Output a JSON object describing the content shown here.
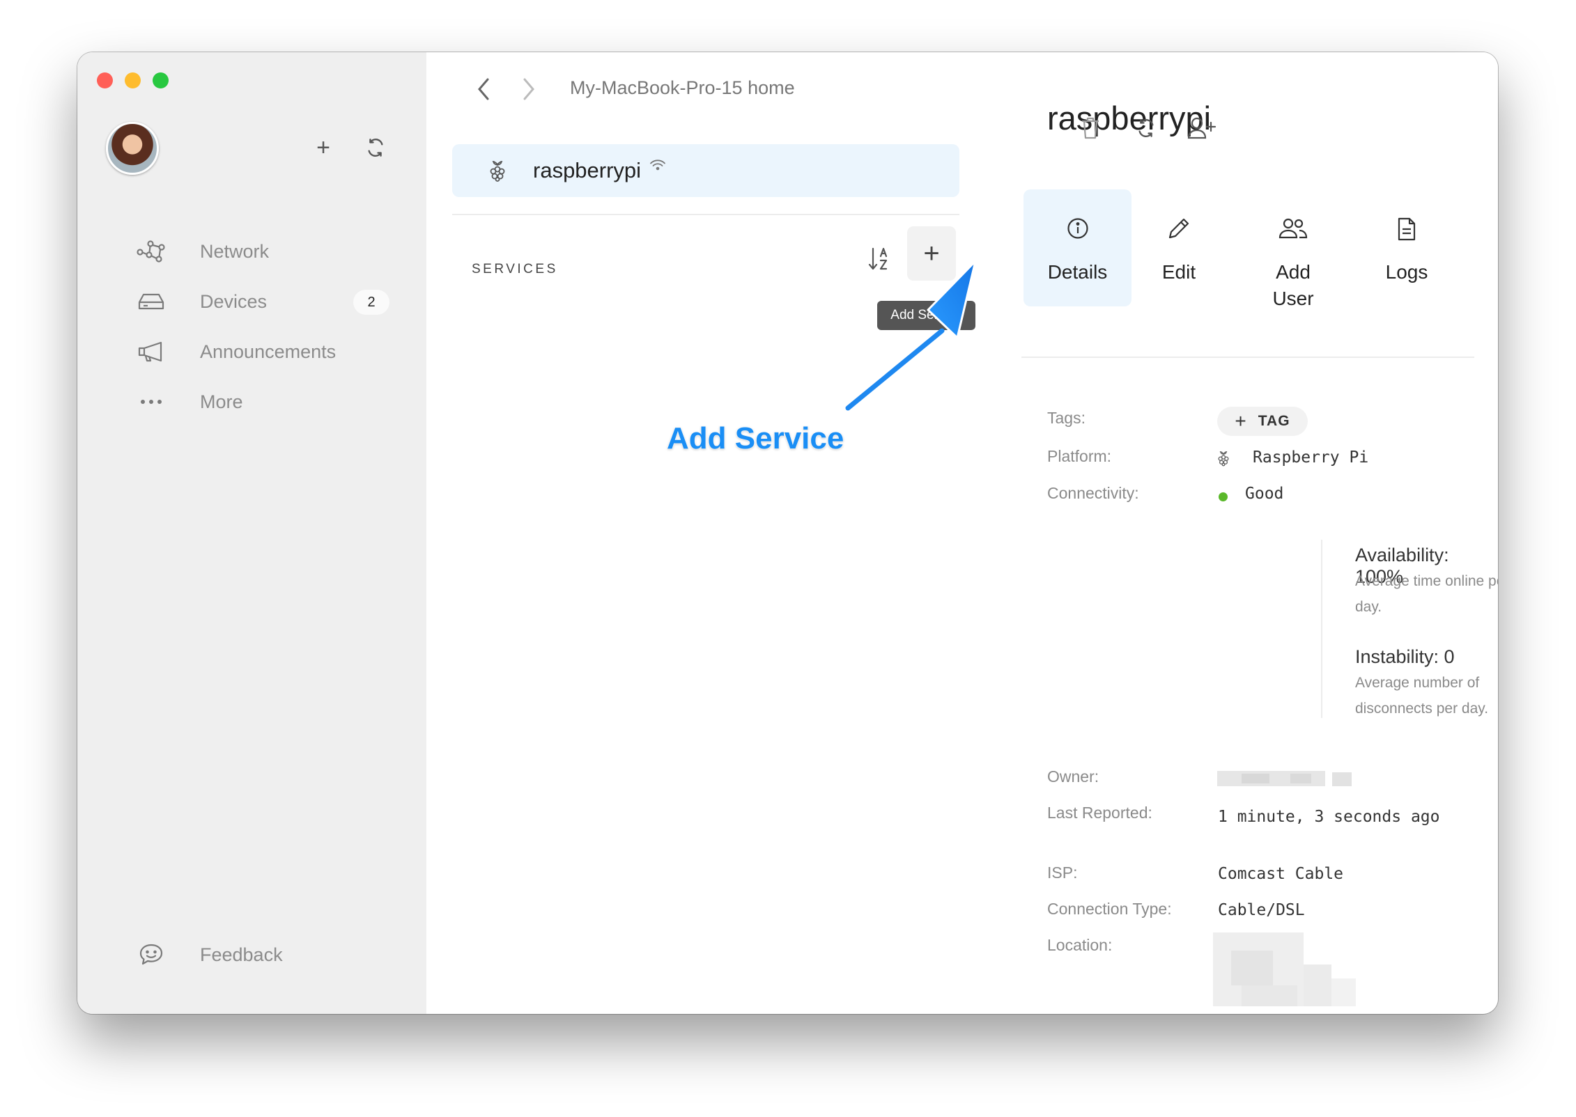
{
  "sidebar": {
    "add_label": "+",
    "nav": [
      {
        "label": "Network",
        "icon": "network-icon"
      },
      {
        "label": "Devices",
        "icon": "devices-icon",
        "badge": "2"
      },
      {
        "label": "Announcements",
        "icon": "megaphone-icon"
      },
      {
        "label": "More",
        "icon": "more-icon"
      }
    ],
    "feedback": {
      "label": "Feedback",
      "icon": "feedback-icon"
    }
  },
  "middle": {
    "breadcrumb": "My-MacBook-Pro-15 home",
    "device": {
      "name": "raspberrypi"
    },
    "services_label": "SERVICES",
    "add_button_label": "+",
    "tooltip": "Add Service",
    "annotation": "Add Service",
    "annotation_color": "#1a8ef5"
  },
  "right": {
    "title": "raspberrypi",
    "tabs": [
      {
        "label": "Details",
        "icon": "info-icon",
        "active": true
      },
      {
        "label": "Edit",
        "icon": "pencil-icon"
      },
      {
        "label": "Add User",
        "icon": "users-icon"
      },
      {
        "label": "Logs",
        "icon": "document-icon"
      }
    ],
    "details": {
      "tags_label": "Tags:",
      "tag_button": "TAG",
      "platform_label": "Platform:",
      "platform_value": "Raspberry Pi",
      "connectivity_label": "Connectivity:",
      "connectivity_value": "Good",
      "connectivity_color": "#5ab82a",
      "availability_title": "Availability: 100%",
      "availability_desc": "Average time online per day.",
      "instability_title": "Instability: 0",
      "instability_desc": "Average number of disconnects per day.",
      "owner_label": "Owner:",
      "last_reported_label": "Last Reported:",
      "last_reported_value": "1 minute, 3 seconds ago",
      "isp_label": "ISP:",
      "isp_value": "Comcast Cable",
      "connection_type_label": "Connection Type:",
      "connection_type_value": "Cable/DSL",
      "location_label": "Location:"
    }
  },
  "colors": {
    "accent_light": "#ebf5fd",
    "sidebar_bg": "#efefef"
  }
}
